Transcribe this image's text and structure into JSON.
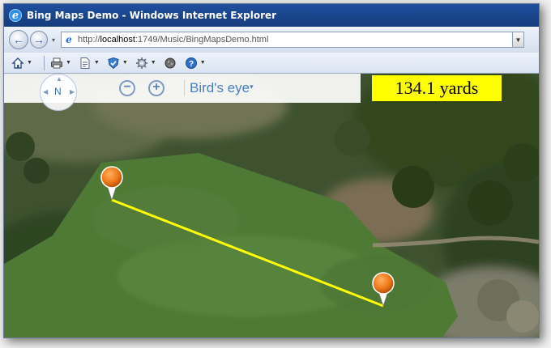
{
  "window": {
    "title": "Bing Maps Demo - Windows Internet Explorer",
    "logo_glyph": "e"
  },
  "address": {
    "url_prefix": "http://",
    "url_host": "localhost",
    "url_rest": ":1749/Music/BingMapsDemo.html"
  },
  "toolbar": {
    "icons": [
      "home-icon",
      "print-icon",
      "page-icon",
      "safety-icon",
      "tools-icon",
      "research-icon",
      "help-icon"
    ]
  },
  "map": {
    "compass_label": "N",
    "zoom_out_label": "−",
    "zoom_in_label": "+",
    "view_mode": "Bird's eye",
    "view_caret": "▾",
    "distance_label": "134.1 yards",
    "line_color": "#ffff00",
    "pin_color": "#f07a1a"
  }
}
